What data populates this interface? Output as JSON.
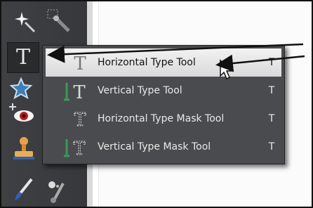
{
  "menu": {
    "items": [
      {
        "label": "Horizontal Type Tool",
        "shortcut": "T",
        "selected": true,
        "icon": "horizontal-type-icon"
      },
      {
        "label": "Vertical Type Tool",
        "shortcut": "T",
        "selected": false,
        "icon": "vertical-type-icon"
      },
      {
        "label": "Horizontal Type Mask Tool",
        "shortcut": "T",
        "selected": false,
        "icon": "horizontal-type-mask-icon"
      },
      {
        "label": "Vertical Type Mask Tool",
        "shortcut": "T",
        "selected": false,
        "icon": "vertical-type-mask-icon"
      }
    ]
  },
  "toolbox": {
    "type_tool_glyph": "T",
    "icons": [
      "magic-wand-icon",
      "quick-selection-icon",
      "type-tool-icon",
      "cookie-cutter-icon",
      "red-eye-removal-icon",
      "clone-stamp-icon",
      "brush-icon",
      "smart-brush-icon"
    ]
  },
  "colors": {
    "toolbox_bg": "#3f4043",
    "menu_bg": "#4a4b4e",
    "selected_bg": "#e6e6e6",
    "accent_green": "#3a9a5b"
  }
}
